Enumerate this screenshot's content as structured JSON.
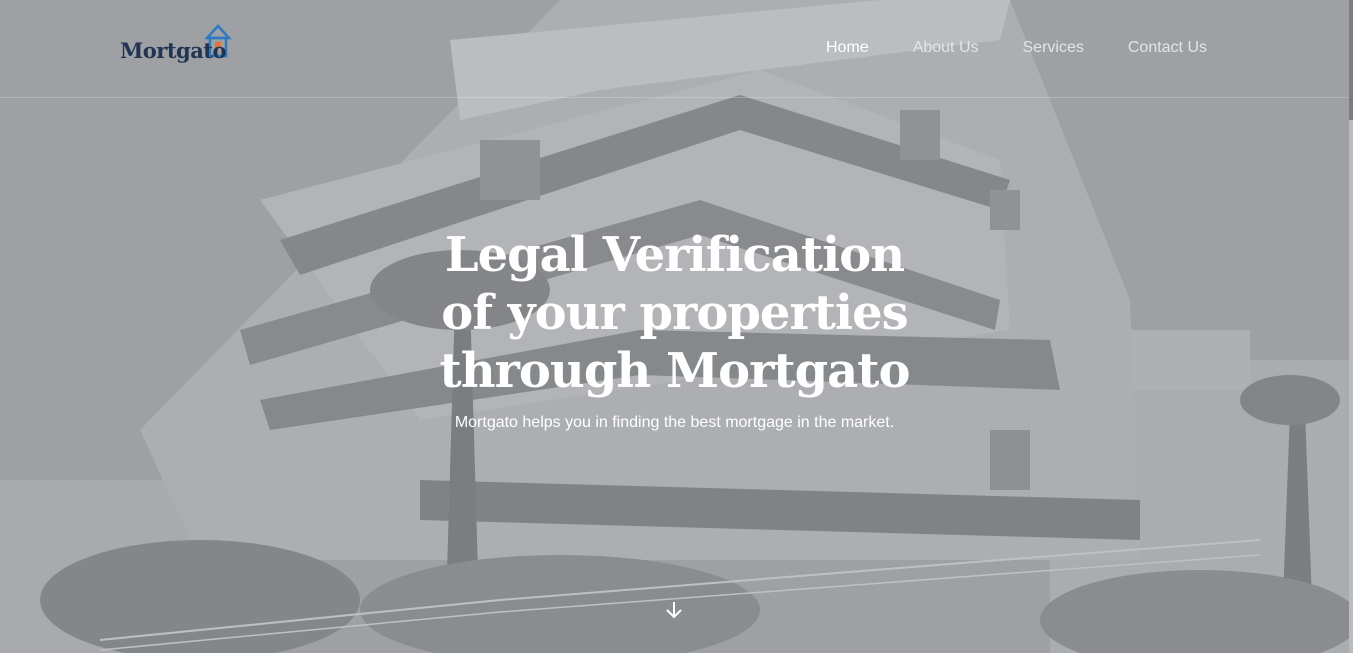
{
  "brand": {
    "name": "Mortgato",
    "logo_color": "#1f3552",
    "logo_accent": "#2b7bc4",
    "logo_accent2": "#e0753a"
  },
  "nav": {
    "items": [
      {
        "label": "Home",
        "active": true
      },
      {
        "label": "About Us",
        "active": false
      },
      {
        "label": "Services",
        "active": false
      },
      {
        "label": "Contact Us",
        "active": false
      }
    ]
  },
  "hero": {
    "title": "Legal Verification of your properties through Mortgato",
    "subtitle": "Mortgato helps you in finding the best mortgage in the market.",
    "scroll_icon": "arrow-down-icon",
    "background_icon": "building-photo"
  }
}
